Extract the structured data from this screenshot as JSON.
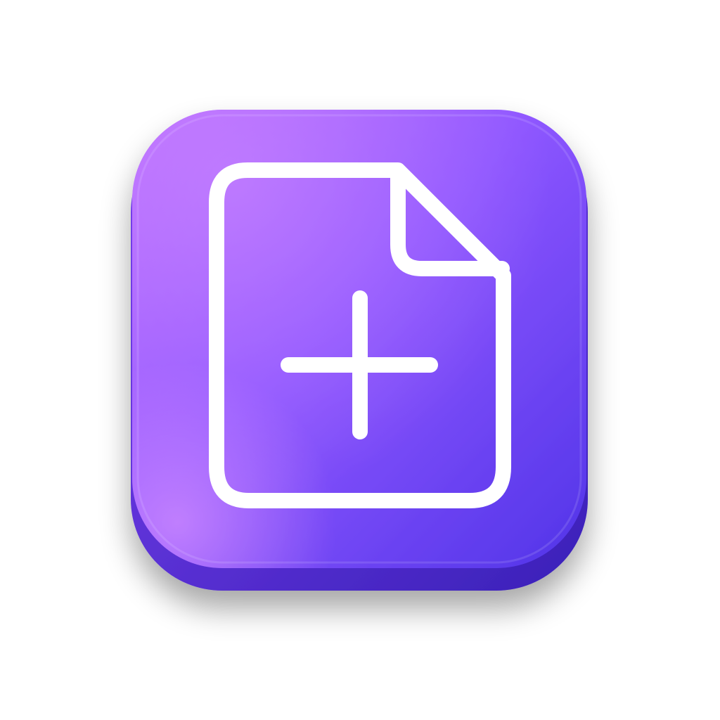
{
  "icon": {
    "name": "new-document-icon",
    "glyph": "document-with-plus",
    "colors": {
      "gradient_top_left": "#b36bff",
      "gradient_mid": "#8a55ff",
      "gradient_bottom_right": "#4f34e6",
      "side_shade": "#3f25c9",
      "glyph_stroke": "#ffffff",
      "background": "#ffffff"
    }
  }
}
